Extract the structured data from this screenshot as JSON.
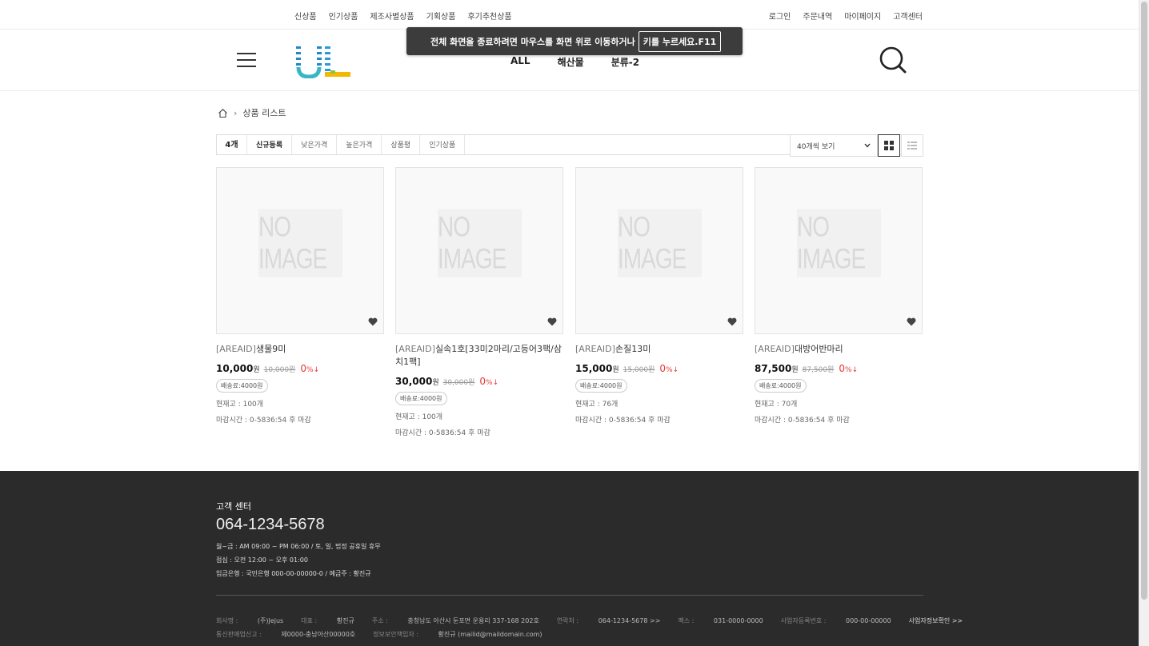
{
  "util": {
    "left": [
      "신상품",
      "인기상품",
      "제조사별상품",
      "기획상품",
      "후기추천상품"
    ],
    "right": [
      "로그인",
      "주문내역",
      "마이페이지",
      "고객센터"
    ]
  },
  "nav": [
    "ALL",
    "해산물",
    "분류-2"
  ],
  "toast": {
    "message": "전체 화면을 종료하려면 마우스를 화면 위로 이동하거나",
    "key": "키를 누르세요.F11"
  },
  "breadcrumb": {
    "current": "상품 리스트"
  },
  "sort": {
    "count": "4개",
    "options": [
      "신규등록",
      "낮은가격",
      "높은가격",
      "상품평",
      "인기상품"
    ],
    "active_index": 0,
    "per_page": "40개씩 보기"
  },
  "products": [
    {
      "tag": "[AREAID]",
      "title": "생물9미",
      "price": "10,000",
      "won": "원",
      "orig": "10,000원",
      "disc": "0",
      "ship": "배송료:4000원",
      "stock": "현재고 : 100개",
      "deadline": "마감시간 : 0-5836:54 후 마감",
      "noimage": "NO IMAGE"
    },
    {
      "tag": "[AREAID]",
      "title": "실속1호[33미2마리/고등어3팩/삼치1팩]",
      "price": "30,000",
      "won": "원",
      "orig": "30,000원",
      "disc": "0",
      "ship": "배송료:4000원",
      "stock": "현재고 : 100개",
      "deadline": "마감시간 : 0-5836:54 후 마감",
      "noimage": "NO IMAGE"
    },
    {
      "tag": "[AREAID]",
      "title": "손질13미",
      "price": "15,000",
      "won": "원",
      "orig": "15,000원",
      "disc": "0",
      "ship": "배송료:4000원",
      "stock": "현재고 : 76개",
      "deadline": "마감시간 : 0-5836:54 후 마감",
      "noimage": "NO IMAGE"
    },
    {
      "tag": "[AREAID]",
      "title": "대방어반마리",
      "price": "87,500",
      "won": "원",
      "orig": "87,500원",
      "disc": "0",
      "ship": "배송료:4000원",
      "stock": "현재고 : 70개",
      "deadline": "마감시간 : 0-5836:54 후 마감",
      "noimage": "NO IMAGE"
    }
  ],
  "disc_unit": "%↓",
  "footer": {
    "cs_title": "고객 센터",
    "phone": "064-1234-5678",
    "hours": "월~금 : AM 09:00 ~ PM 06:00  /  토, 일, 법정 공휴일 휴무",
    "lunch": "점심 : 오전 12:00 ~ 오후 01:00",
    "bank": "입금은행 : 국민은행 000-00-00000-0  /  예금주 : 황진규",
    "company_label": "회사명 : ",
    "company": "(주)Jejus",
    "ceo_label": "대표 : ",
    "ceo": "황진규",
    "address_label": "주소 : ",
    "address": "충청남도 아산시 둔포면 운용리 337-168 202호",
    "contact_label": "연락처 : ",
    "contact": "064-1234-5678 >>",
    "fax_label": "팩스 : ",
    "fax": "031-0000-0000",
    "bizno_label": "사업자등록번호 : ",
    "bizno": "000-00-00000",
    "bizinfo": "사업자정보확인 >>",
    "ecommerce_label": "통신판매업신고 : ",
    "ecommerce": "제0000-충남아산00000호",
    "privacy_label": "정보보안책임자 : ",
    "privacy": "황진규 (mailid@maildomain.com)"
  },
  "colors": {
    "accent_red": "#e53935",
    "footer_bg": "#2b2b2b",
    "logo_blue": "#1e88c8",
    "logo_cyan": "#38b6c6",
    "logo_yellow": "#f5b800"
  }
}
